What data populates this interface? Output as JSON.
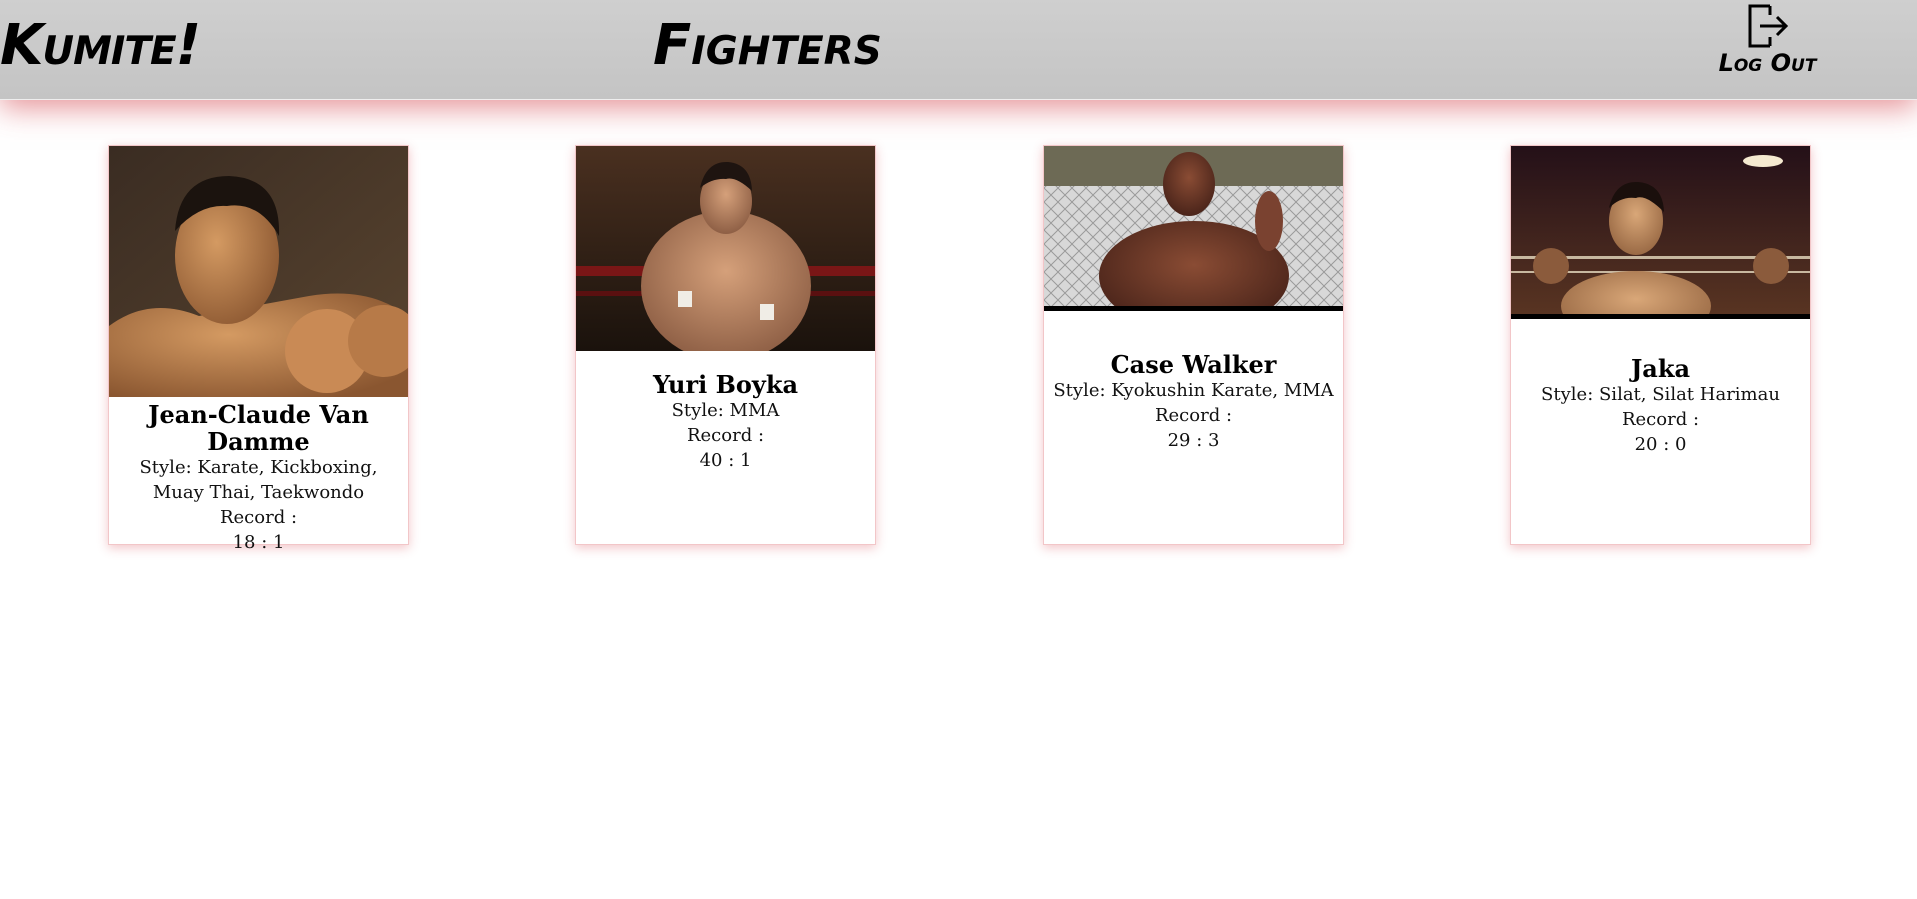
{
  "header": {
    "brand": "Kumite!",
    "title": "Fighters",
    "logout_label": "Log Out",
    "logout_icon": "logout-door-icon"
  },
  "fighters": [
    {
      "name": "Jean-Claude Van Damme",
      "style": "Style: Karate, Kickboxing, Muay Thai, Taekwondo",
      "record_label": "Record :",
      "record": "18 : 1"
    },
    {
      "name": "Yuri Boyka",
      "style": "Style: MMA",
      "record_label": "Record :",
      "record": "40 : 1"
    },
    {
      "name": "Case Walker",
      "style": "Style: Kyokushin Karate, MMA",
      "record_label": "Record :",
      "record": "29 : 3"
    },
    {
      "name": "Jaka",
      "style": "Style: Silat, Silat Harimau",
      "record_label": "Record :",
      "record": "20 : 0"
    }
  ],
  "colors": {
    "header_bg": "#c8c8c8",
    "shadow_accent": "#d64b55",
    "card_border": "#f2c6c8"
  }
}
